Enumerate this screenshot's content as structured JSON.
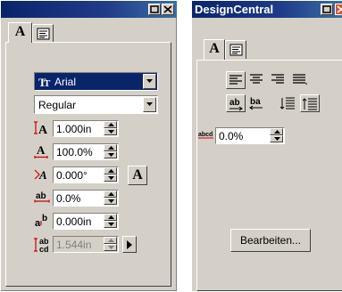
{
  "left_panel": {
    "tabs": [
      {
        "label": "A",
        "icon": "character-tab"
      },
      {
        "label": "",
        "icon": "paragraph-align-icon"
      }
    ],
    "font_name": "Arial",
    "font_style": "Regular",
    "fields": [
      {
        "icon": "height-icon",
        "value": "1.000in"
      },
      {
        "icon": "width-factor-icon",
        "value": "100.0%"
      },
      {
        "icon": "oblique-angle-icon",
        "value": "0.000°"
      },
      {
        "icon": "tracking-icon",
        "value": "0.0%"
      },
      {
        "icon": "baseline-shift-icon",
        "value": "0.000in"
      },
      {
        "icon": "line-spacing-icon",
        "value": "1.544in"
      }
    ],
    "a_button_label": "A"
  },
  "right_panel": {
    "title": "DesignCentral",
    "tabs": [
      {
        "label": "A",
        "icon": "character-tab"
      },
      {
        "label": "",
        "icon": "paragraph-align-icon"
      }
    ],
    "spacing_value": "0.0%",
    "edit_button_label": "Bearbeiten..."
  },
  "colors": {
    "title_bar": "#0a246a",
    "face": "#d4d0c8",
    "selection": "#0a246a",
    "close_red": "#d9532c"
  }
}
